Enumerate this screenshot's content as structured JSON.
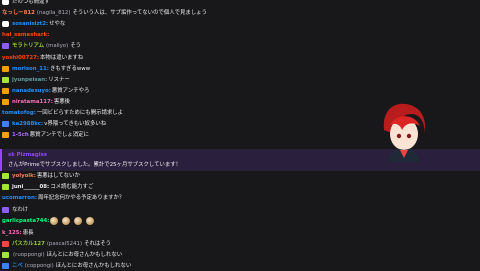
{
  "chat": {
    "messages": [
      {
        "badges": [
          "wave"
        ],
        "name": "",
        "alt": "",
        "text": "たのつも間違ず",
        "color": "#a970ff"
      },
      {
        "badges": [],
        "name": "なっしー812",
        "alt": "(nagila_812)",
        "text": "そういう人は、サブ垢作ってないので個人で見ましょう",
        "color": "#ff7f50"
      },
      {
        "badges": [
          "wave"
        ],
        "name": "sosanisizt2:",
        "alt": "",
        "text": "せやな",
        "color": "#1e90ff"
      },
      {
        "badges": [],
        "name": "hal_sameshark:",
        "alt": "",
        "text": "",
        "color": "#ff4500"
      },
      {
        "badges": [
          "sq"
        ],
        "name": "モラトリアム",
        "alt": "(maliyo)",
        "text": "そう",
        "color": "#9acd32"
      },
      {
        "badges": [],
        "name": "yoshi00727:",
        "alt": "",
        "text": "本物は違いますね",
        "color": "#ff4500"
      },
      {
        "badges": [
          "camp"
        ],
        "name": "morison_11:",
        "alt": "",
        "text": "きもすぎるwww",
        "color": "#1e90ff"
      },
      {
        "badges": [
          "arrow"
        ],
        "name": "jyunpeisan:",
        "alt": "",
        "text": "リスナー",
        "color": "#5f9ea0"
      },
      {
        "badges": [
          "camp"
        ],
        "name": "nanadesuyo:",
        "alt": "",
        "text": "悪質アンチやろ",
        "color": "#1e90ff"
      },
      {
        "badges": [
          "camp"
        ],
        "name": "niratama117:",
        "alt": "",
        "text": "害悪後",
        "color": "#ff69b4"
      },
      {
        "badges": [],
        "name": "tomatofog:",
        "alt": "",
        "text": "一回ビビらすためにも開示請求しよ",
        "color": "#1e90ff"
      },
      {
        "badges": [
          "blue"
        ],
        "name": "ka2988kc:",
        "alt": "",
        "text": "v界隈ってきもい奴多いね",
        "color": "#1e90ff"
      },
      {
        "badges": [
          "camp"
        ],
        "name": "1-5ch",
        "alt": "",
        "text": "悪質アンチでしょ消定に",
        "color": "#a970ff"
      }
    ],
    "highlight": {
      "name": "sk Pizmagiss",
      "line": "さんがPrimeでサブスクしました。累計で25ヶ月サブスクしています！",
      "name_color": "#9146ff"
    },
    "after": [
      {
        "badges": [
          "arrow"
        ],
        "name": "yolyolk:",
        "alt": "",
        "text": "害悪はしてないか",
        "color": "#ff7f50"
      },
      {
        "badges": [
          "arrow"
        ],
        "name": "juni______08:",
        "alt": "",
        "text": "コメ読む能力すご",
        "color": "#efeff1"
      },
      {
        "badges": [],
        "name": "ucomarron:",
        "alt": "",
        "text": "周年記念何かやる予定ありますか？",
        "color": "#1e90ff"
      },
      {
        "badges": [
          "sq"
        ],
        "name": "",
        "alt": "",
        "text": "なわけ",
        "color": "#1e90ff"
      },
      {
        "badges": [],
        "name": "garlicpasta744:",
        "alt": "",
        "text": "",
        "color": "#00ff7f"
      },
      {
        "badges": [],
        "name": "k_125:",
        "alt": "",
        "text": "患長",
        "color": "#ff69b4"
      },
      {
        "badges": [
          "red"
        ],
        "name": "パスカル127",
        "alt": "(pascal5241)",
        "text": "それはそう",
        "color": "#9acd32"
      },
      {
        "badges": [
          "arrow"
        ],
        "name": "",
        "alt": "(ruoppongi)",
        "text": "ほんとにお母さんかもしれない",
        "color": "#1e90ff"
      },
      {
        "badges": [
          "blue"
        ],
        "name": "こべ",
        "alt": "(coppongi)",
        "text": "ほんとにお母さんかもしれない",
        "color": "#1e90ff"
      }
    ]
  }
}
